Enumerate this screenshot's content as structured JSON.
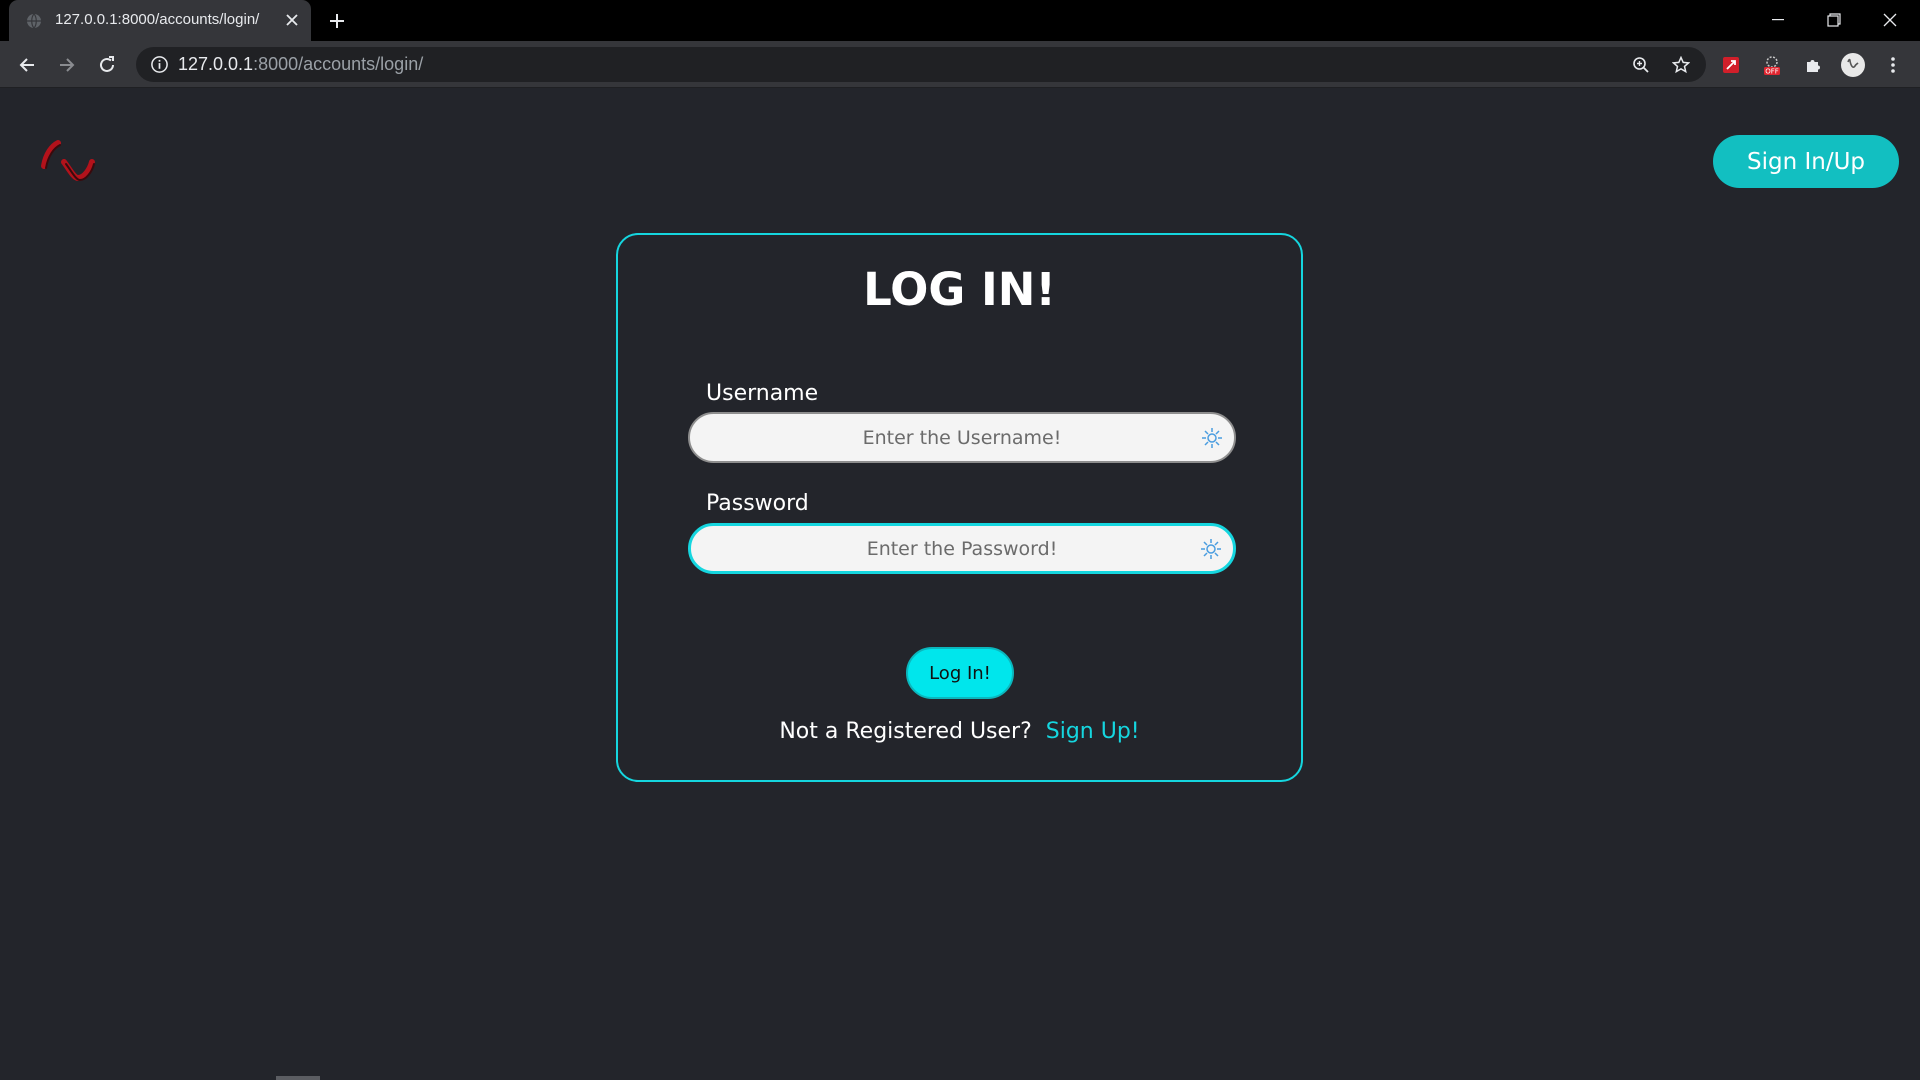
{
  "browser": {
    "tab_title": "127.0.0.1:8000/accounts/login/",
    "url_host": "127.0.0.1",
    "url_path": ":8000/accounts/login/"
  },
  "header": {
    "signin_label": "Sign In/Up"
  },
  "login_card": {
    "title": "LOG IN!",
    "username_label": "Username",
    "username_placeholder": "Enter the Username!",
    "password_label": "Password",
    "password_placeholder": "Enter the Password!",
    "submit_label": "Log In!",
    "footer_text": "Not a Registered User?",
    "signup_link": "Sign Up!"
  },
  "colors": {
    "accent": "#15d6df",
    "button_fill": "#00e6ec",
    "header_button": "#12bfc1",
    "logo_red": "#b3121b",
    "page_bg": "#23252b"
  },
  "icons": {
    "field_icon": "sparkle-icon",
    "logo": "logo-icon"
  }
}
